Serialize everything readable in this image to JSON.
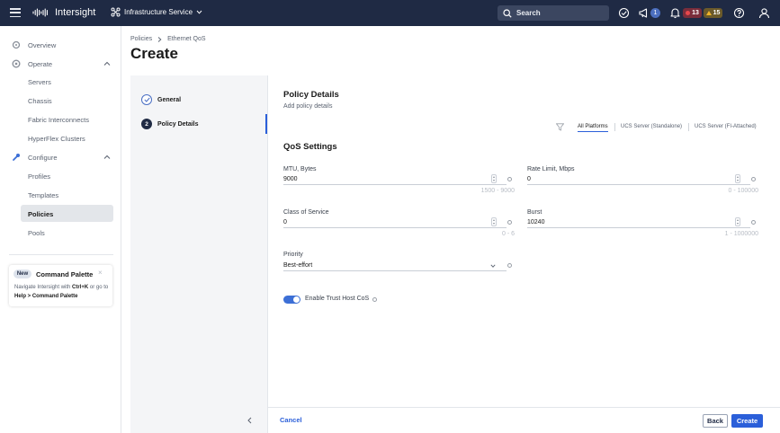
{
  "topbar": {
    "brand": "Intersight",
    "service": "Infrastructure Service",
    "search_placeholder": "Search",
    "notifications_count": "1",
    "alarms_critical": "13",
    "alarms_warning": "15",
    "icons": [
      "menu-icon",
      "cisco-logo",
      "service-switcher-icon",
      "search-icon",
      "tasks-check-icon",
      "announcement-icon",
      "bell-icon",
      "help-icon",
      "user-icon"
    ],
    "colors": {
      "bar_bg": "#1f2a44",
      "critical": "#e5484d",
      "warning": "#f0b429"
    }
  },
  "sidebar": {
    "items": [
      {
        "label": "Overview",
        "icon": "overview-icon"
      },
      {
        "label": "Operate",
        "icon": "operate-icon"
      },
      {
        "label": "Servers"
      },
      {
        "label": "Chassis"
      },
      {
        "label": "Fabric Interconnects"
      },
      {
        "label": "HyperFlex Clusters"
      },
      {
        "label": "Configure",
        "icon": "configure-icon"
      },
      {
        "label": "Profiles"
      },
      {
        "label": "Templates"
      },
      {
        "label": "Policies",
        "active": true
      },
      {
        "label": "Pools"
      }
    ],
    "command_palette": {
      "badge": "New",
      "title": "Command Palette",
      "desc_prefix": "Navigate Intersight with ",
      "desc_keys": "Ctrl+K",
      "desc_middle": " or go to ",
      "desc_path": "Help > Command Palette"
    }
  },
  "breadcrumb": {
    "parent": "Policies",
    "current": "Ethernet QoS"
  },
  "page_title": "Create",
  "wizard": {
    "steps": [
      {
        "label": "General",
        "state": "done"
      },
      {
        "label": "Policy Details",
        "number": "2",
        "state": "active"
      }
    ]
  },
  "form": {
    "title": "Policy Details",
    "subtitle": "Add policy details",
    "platforms": [
      "All Platforms",
      "UCS Server (Standalone)",
      "UCS Server (FI-Attached)"
    ],
    "active_platform": "All Platforms",
    "qos_title": "QoS Settings",
    "mtu": {
      "label": "MTU, Bytes",
      "value": "9000",
      "range": "1500 - 9000"
    },
    "rate_limit": {
      "label": "Rate Limit, Mbps",
      "value": "0",
      "range": "0 - 100000"
    },
    "cos": {
      "label": "Class of Service",
      "value": "0",
      "range": "0 - 6"
    },
    "burst": {
      "label": "Burst",
      "value": "10240",
      "range": "1 - 1000000"
    },
    "priority": {
      "label": "Priority",
      "value": "Best-effort"
    },
    "trust_host_cos": {
      "label": "Enable Trust Host CoS",
      "enabled": true
    }
  },
  "footer": {
    "cancel": "Cancel",
    "back": "Back",
    "create": "Create"
  }
}
